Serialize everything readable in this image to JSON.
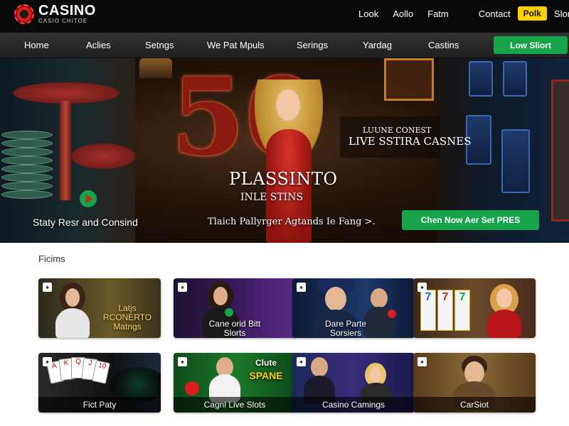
{
  "header": {
    "logo_title": "CASINO",
    "logo_subtitle": "CASIO CHITOE",
    "links": [
      "Look",
      "Aollo",
      "Fatm",
      "Contact",
      "Polk",
      "Slont"
    ]
  },
  "nav": {
    "items": [
      "Home",
      "Aclies",
      "Setngs",
      "We Pat Mpuls",
      "Serings",
      "Yardag",
      "Castins"
    ],
    "cta": "Low Sliort"
  },
  "hero": {
    "big_number": "50",
    "promo_small": "LUUNE CONEST",
    "promo_big": "LIVE SSTIRA CASNES",
    "title": "PLASSINTO",
    "subtitle": "INLE STINS",
    "left_text": "Staty Resr and Consind",
    "link_text": "Tlaich Pallyrger Agtands Ie Fang >.",
    "cta": "Chen Now Aer Set PRES"
  },
  "section": {
    "heading": "Ficims"
  },
  "cards": [
    {
      "label": "Latjs\nRCONERTO\nMatngs"
    },
    {
      "label": "Cane orid Bitt\nSlorts"
    },
    {
      "label": "Dare Parte\nSorsiers"
    },
    {
      "label": ""
    },
    {
      "label": "Fict Paty"
    },
    {
      "label": "Cagnl Live Slots"
    },
    {
      "label": "Casino Camings"
    },
    {
      "label": "CarSiot"
    }
  ],
  "cards_badge": "♠",
  "card_art": {
    "slot_reels": [
      "7",
      "7",
      "7"
    ],
    "playing_cards": [
      "A",
      "K",
      "Q",
      "J",
      "10"
    ],
    "sign": "Clute",
    "sign_big": "SPANE"
  },
  "colors": {
    "accent_green": "#16a34a",
    "accent_yellow": "#ffd000",
    "brand_red": "#d81e1e"
  },
  "icons": {
    "logo": "casino-chip-icon",
    "play": "play-icon",
    "card_badge": "card-badge-icon",
    "card_corner": "bookmark-icon"
  }
}
